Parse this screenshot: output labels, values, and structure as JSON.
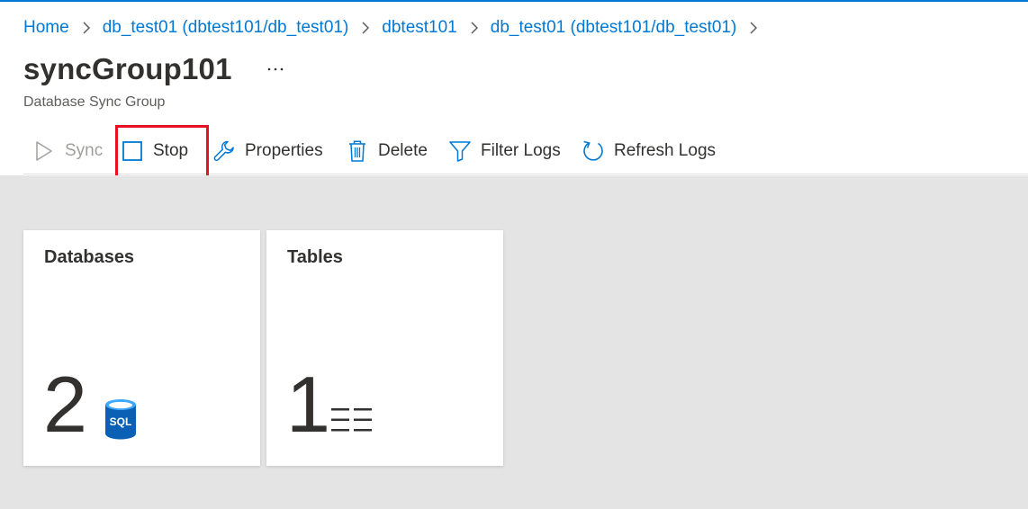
{
  "breadcrumb": {
    "items": [
      {
        "label": "Home"
      },
      {
        "label": "db_test01 (dbtest101/db_test01)"
      },
      {
        "label": "dbtest101"
      },
      {
        "label": "db_test01 (dbtest101/db_test01)"
      }
    ]
  },
  "header": {
    "title": "syncGroup101",
    "more_label": "...",
    "subtitle": "Database Sync Group"
  },
  "toolbar": {
    "sync_label": "Sync",
    "stop_label": "Stop",
    "properties_label": "Properties",
    "delete_label": "Delete",
    "filter_logs_label": "Filter Logs",
    "refresh_logs_label": "Refresh Logs"
  },
  "tiles": {
    "databases": {
      "title": "Databases",
      "value": "2",
      "icon_text": "SQL",
      "icon": "sql-database-icon"
    },
    "tables": {
      "title": "Tables",
      "value": "1",
      "icon": "table-list-icon"
    }
  },
  "colors": {
    "accent": "#0078d4",
    "highlight": "#e81123",
    "content_bg": "#e4e4e4",
    "disabled": "#a19f9d"
  }
}
